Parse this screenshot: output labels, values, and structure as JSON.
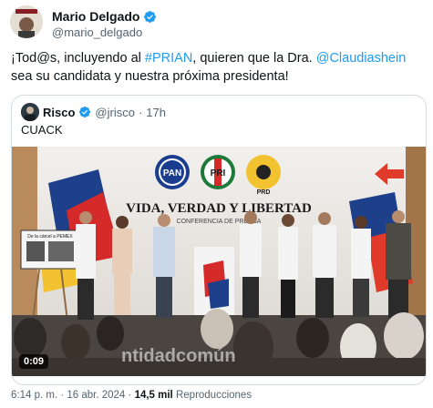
{
  "author": {
    "name": "Mario Delgado",
    "handle": "@mario_delgado",
    "avatar_text": "MARIO DELGADO"
  },
  "tweet": {
    "text_prefix": "¡Tod@s, incluyendo al ",
    "hashtag": "#PRIAN",
    "text_mid": ", quieren que la Dra. ",
    "mention": "@Claudiashein",
    "text_suffix": " sea su candidata y nuestra próxima presidenta!"
  },
  "quote": {
    "name": "Risco",
    "handle": "@jrisco",
    "time": "17h",
    "text": "CUACK",
    "video": {
      "duration": "0:09",
      "banner_title": "VIDA, VERDAD Y LIBERTAD",
      "banner_subtitle": "CONFERENCIA DE PRENSA",
      "logos": [
        "PAN",
        "PRI",
        "PRD"
      ],
      "watermark": "ntidadcomún",
      "poster_text": "De la cárcel a PEMEX"
    }
  },
  "footer": {
    "time": "6:14 p. m.",
    "date": "16 abr. 2024",
    "views": "14,5 mil",
    "views_label": "Reproducciones"
  },
  "colors": {
    "link": "#1d9bf0",
    "verified": "#1d9bf0",
    "muted": "#536471"
  }
}
